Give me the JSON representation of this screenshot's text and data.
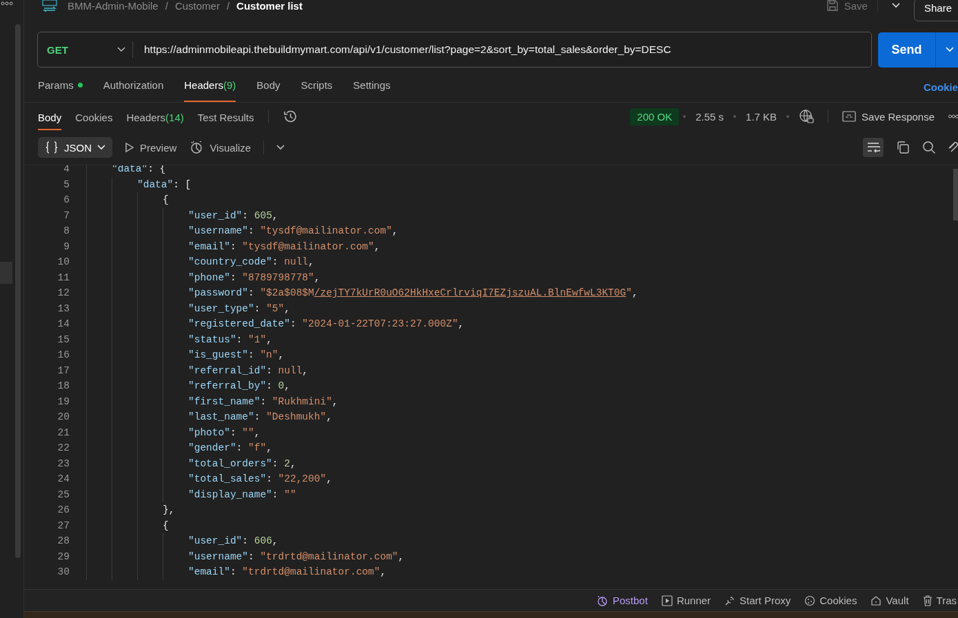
{
  "breadcrumb": {
    "items": [
      "BMM-Admin-Mobile",
      "Customer",
      "Customer list"
    ],
    "separator": "/"
  },
  "top_actions": {
    "save": "Save",
    "save_disabled": true,
    "share": "Share"
  },
  "request": {
    "method": "GET",
    "url": "https://adminmobileapi.thebuildmymart.com/api/v1/customer/list?page=2&sort_by=total_sales&order_by=DESC",
    "send": "Send"
  },
  "request_tabs": [
    {
      "label": "Params",
      "dot": true,
      "selected": false
    },
    {
      "label": "Authorization",
      "dot": false,
      "selected": false
    },
    {
      "label": "Headers",
      "count": "(9)",
      "dot": false,
      "selected": true
    },
    {
      "label": "Body",
      "dot": false,
      "selected": false
    },
    {
      "label": "Scripts",
      "dot": false,
      "selected": false
    },
    {
      "label": "Settings",
      "dot": false,
      "selected": false
    }
  ],
  "cookies_link": "Cookie",
  "response_tabs": [
    {
      "label": "Body",
      "selected": true
    },
    {
      "label": "Cookies",
      "selected": false
    },
    {
      "label": "Headers",
      "count": "(14)",
      "selected": false
    },
    {
      "label": "Test Results",
      "selected": false
    }
  ],
  "response_meta": {
    "status": "200 OK",
    "time": "2.55 s",
    "size": "1.7 KB",
    "save_response": "Save Response"
  },
  "view_toolbar": {
    "format": "JSON",
    "preview": "Preview",
    "visualize": "Visualize",
    "wrap_on": true
  },
  "code_lines": [
    {
      "num": "4",
      "parts": [
        {
          "kind": "key",
          "text": "\"data\""
        },
        {
          "kind": "punct",
          "text": ": {"
        }
      ],
      "children": [
        {
          "num": "5",
          "parts": [
            {
              "kind": "key",
              "text": "\"data\""
            },
            {
              "kind": "punct",
              "text": ": ["
            }
          ],
          "children": [
            {
              "num": "6",
              "parts": [
                {
                  "kind": "punct",
                  "text": "{"
                }
              ],
              "children": [
                {
                  "num": "7",
                  "parts": [
                    {
                      "kind": "key",
                      "text": "\"user_id\""
                    },
                    {
                      "kind": "punct",
                      "text": ": "
                    },
                    {
                      "kind": "number",
                      "text": "605"
                    },
                    {
                      "kind": "punct",
                      "text": ","
                    }
                  ]
                },
                {
                  "num": "8",
                  "parts": [
                    {
                      "kind": "key",
                      "text": "\"username\""
                    },
                    {
                      "kind": "punct",
                      "text": ": "
                    },
                    {
                      "kind": "string",
                      "text": "\"tysdf@mailinator.com\""
                    },
                    {
                      "kind": "punct",
                      "text": ","
                    }
                  ]
                },
                {
                  "num": "9",
                  "parts": [
                    {
                      "kind": "key",
                      "text": "\"email\""
                    },
                    {
                      "kind": "punct",
                      "text": ": "
                    },
                    {
                      "kind": "string",
                      "text": "\"tysdf@mailinator.com\""
                    },
                    {
                      "kind": "punct",
                      "text": ","
                    }
                  ]
                },
                {
                  "num": "10",
                  "parts": [
                    {
                      "kind": "key",
                      "text": "\"country_code\""
                    },
                    {
                      "kind": "punct",
                      "text": ": "
                    },
                    {
                      "kind": "null",
                      "text": "null"
                    },
                    {
                      "kind": "punct",
                      "text": ","
                    }
                  ]
                },
                {
                  "num": "11",
                  "parts": [
                    {
                      "kind": "key",
                      "text": "\"phone\""
                    },
                    {
                      "kind": "punct",
                      "text": ": "
                    },
                    {
                      "kind": "string",
                      "text": "\"8789798778\""
                    },
                    {
                      "kind": "punct",
                      "text": ","
                    }
                  ]
                },
                {
                  "num": "12",
                  "parts": [
                    {
                      "kind": "key",
                      "text": "\"password\""
                    },
                    {
                      "kind": "punct",
                      "text": ": "
                    },
                    {
                      "kind": "string",
                      "text": "\"$2a$08$M"
                    },
                    {
                      "kind": "link",
                      "text": "/zejTY7kUrR0uO62HkHxeCrlrviqI7EZjszuAL.BlnEwfwL3KT0G"
                    },
                    {
                      "kind": "string",
                      "text": "\""
                    },
                    {
                      "kind": "punct",
                      "text": ","
                    }
                  ]
                },
                {
                  "num": "13",
                  "parts": [
                    {
                      "kind": "key",
                      "text": "\"user_type\""
                    },
                    {
                      "kind": "punct",
                      "text": ": "
                    },
                    {
                      "kind": "string",
                      "text": "\"5\""
                    },
                    {
                      "kind": "punct",
                      "text": ","
                    }
                  ]
                },
                {
                  "num": "14",
                  "parts": [
                    {
                      "kind": "key",
                      "text": "\"registered_date\""
                    },
                    {
                      "kind": "punct",
                      "text": ": "
                    },
                    {
                      "kind": "string",
                      "text": "\"2024-01-22T07:23:27.000Z\""
                    },
                    {
                      "kind": "punct",
                      "text": ","
                    }
                  ]
                },
                {
                  "num": "15",
                  "parts": [
                    {
                      "kind": "key",
                      "text": "\"status\""
                    },
                    {
                      "kind": "punct",
                      "text": ": "
                    },
                    {
                      "kind": "string",
                      "text": "\"1\""
                    },
                    {
                      "kind": "punct",
                      "text": ","
                    }
                  ]
                },
                {
                  "num": "16",
                  "parts": [
                    {
                      "kind": "key",
                      "text": "\"is_guest\""
                    },
                    {
                      "kind": "punct",
                      "text": ": "
                    },
                    {
                      "kind": "string",
                      "text": "\"n\""
                    },
                    {
                      "kind": "punct",
                      "text": ","
                    }
                  ]
                },
                {
                  "num": "17",
                  "parts": [
                    {
                      "kind": "key",
                      "text": "\"referral_id\""
                    },
                    {
                      "kind": "punct",
                      "text": ": "
                    },
                    {
                      "kind": "null",
                      "text": "null"
                    },
                    {
                      "kind": "punct",
                      "text": ","
                    }
                  ]
                },
                {
                  "num": "18",
                  "parts": [
                    {
                      "kind": "key",
                      "text": "\"referral_by\""
                    },
                    {
                      "kind": "punct",
                      "text": ": "
                    },
                    {
                      "kind": "number",
                      "text": "0"
                    },
                    {
                      "kind": "punct",
                      "text": ","
                    }
                  ]
                },
                {
                  "num": "19",
                  "parts": [
                    {
                      "kind": "key",
                      "text": "\"first_name\""
                    },
                    {
                      "kind": "punct",
                      "text": ": "
                    },
                    {
                      "kind": "string",
                      "text": "\"Rukhmini\""
                    },
                    {
                      "kind": "punct",
                      "text": ","
                    }
                  ]
                },
                {
                  "num": "20",
                  "parts": [
                    {
                      "kind": "key",
                      "text": "\"last_name\""
                    },
                    {
                      "kind": "punct",
                      "text": ": "
                    },
                    {
                      "kind": "string",
                      "text": "\"Deshmukh\""
                    },
                    {
                      "kind": "punct",
                      "text": ","
                    }
                  ]
                },
                {
                  "num": "21",
                  "parts": [
                    {
                      "kind": "key",
                      "text": "\"photo\""
                    },
                    {
                      "kind": "punct",
                      "text": ": "
                    },
                    {
                      "kind": "string",
                      "text": "\"\""
                    },
                    {
                      "kind": "punct",
                      "text": ","
                    }
                  ]
                },
                {
                  "num": "22",
                  "parts": [
                    {
                      "kind": "key",
                      "text": "\"gender\""
                    },
                    {
                      "kind": "punct",
                      "text": ": "
                    },
                    {
                      "kind": "string",
                      "text": "\"f\""
                    },
                    {
                      "kind": "punct",
                      "text": ","
                    }
                  ]
                },
                {
                  "num": "23",
                  "parts": [
                    {
                      "kind": "key",
                      "text": "\"total_orders\""
                    },
                    {
                      "kind": "punct",
                      "text": ": "
                    },
                    {
                      "kind": "number",
                      "text": "2"
                    },
                    {
                      "kind": "punct",
                      "text": ","
                    }
                  ]
                },
                {
                  "num": "24",
                  "parts": [
                    {
                      "kind": "key",
                      "text": "\"total_sales\""
                    },
                    {
                      "kind": "punct",
                      "text": ": "
                    },
                    {
                      "kind": "string",
                      "text": "\"22,200\""
                    },
                    {
                      "kind": "punct",
                      "text": ","
                    }
                  ]
                },
                {
                  "num": "25",
                  "parts": [
                    {
                      "kind": "key",
                      "text": "\"display_name\""
                    },
                    {
                      "kind": "punct",
                      "text": ": "
                    },
                    {
                      "kind": "string",
                      "text": "\"\""
                    }
                  ]
                }
              ]
            },
            {
              "num": "26",
              "parts": [
                {
                  "kind": "punct",
                  "text": "},"
                }
              ]
            },
            {
              "num": "27",
              "parts": [
                {
                  "kind": "punct",
                  "text": "{"
                }
              ],
              "children": [
                {
                  "num": "28",
                  "parts": [
                    {
                      "kind": "key",
                      "text": "\"user_id\""
                    },
                    {
                      "kind": "punct",
                      "text": ": "
                    },
                    {
                      "kind": "number",
                      "text": "606"
                    },
                    {
                      "kind": "punct",
                      "text": ","
                    }
                  ]
                },
                {
                  "num": "29",
                  "parts": [
                    {
                      "kind": "key",
                      "text": "\"username\""
                    },
                    {
                      "kind": "punct",
                      "text": ": "
                    },
                    {
                      "kind": "string",
                      "text": "\"trdrtd@mailinator.com\""
                    },
                    {
                      "kind": "punct",
                      "text": ","
                    }
                  ]
                },
                {
                  "num": "30",
                  "parts": [
                    {
                      "kind": "key",
                      "text": "\"email\""
                    },
                    {
                      "kind": "punct",
                      "text": ": "
                    },
                    {
                      "kind": "string",
                      "text": "\"trdrtd@mailinator.com\""
                    },
                    {
                      "kind": "punct",
                      "text": ","
                    }
                  ]
                }
              ]
            }
          ]
        }
      ]
    }
  ],
  "status_bar": [
    {
      "kind": "postbot",
      "label": "Postbot"
    },
    {
      "kind": "runner",
      "label": "Runner"
    },
    {
      "kind": "proxy",
      "label": "Start Proxy"
    },
    {
      "kind": "cookies",
      "label": "Cookies"
    },
    {
      "kind": "vault",
      "label": "Vault"
    },
    {
      "kind": "trash",
      "label": "Tras"
    }
  ]
}
